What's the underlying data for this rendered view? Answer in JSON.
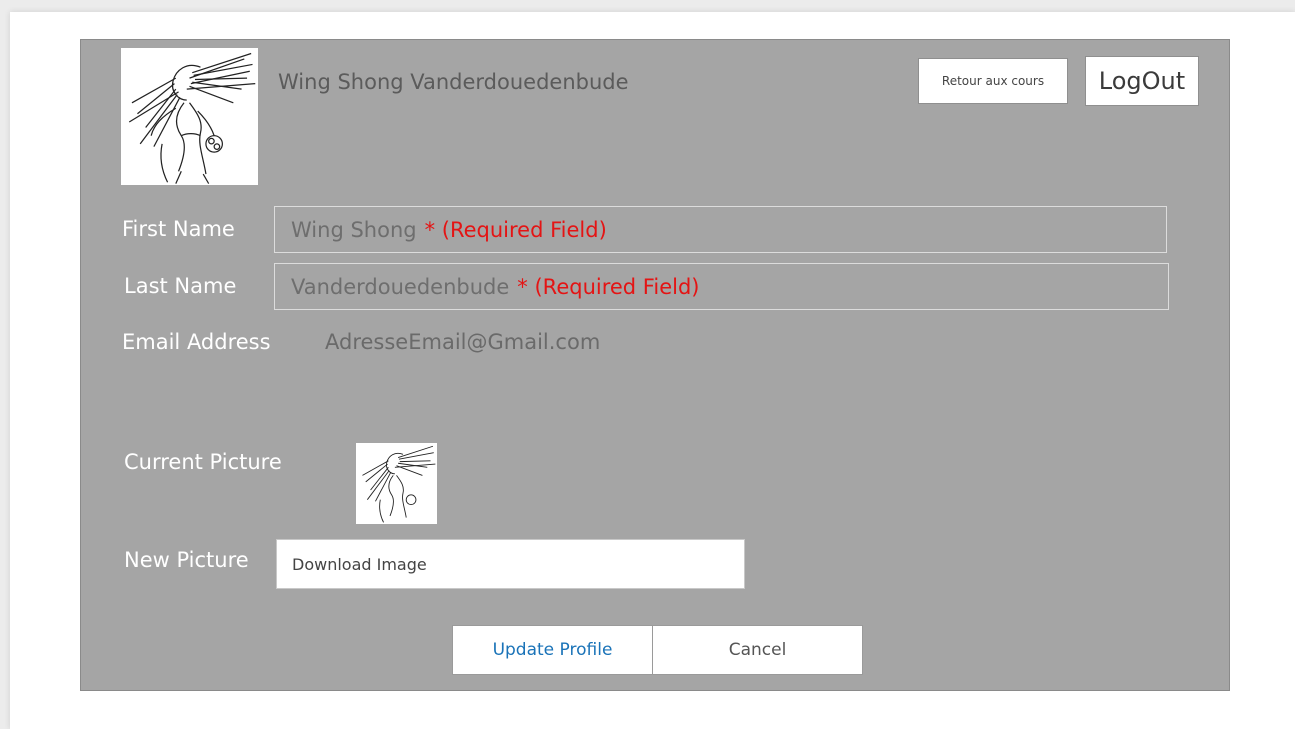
{
  "header": {
    "user_name": "Wing Shong Vanderdouedenbude",
    "back_button_label": "Retour aux cours",
    "logout_button_label": "LogOut",
    "avatar_icon": "profile-sketch-image"
  },
  "form": {
    "first_name": {
      "label": "First Name",
      "value": "Wing Shong",
      "required_text": "* (Required Field)"
    },
    "last_name": {
      "label": "Last Name",
      "value": "Vanderdouedenbude",
      "required_text": "* (Required Field)"
    },
    "email": {
      "label": "Email Address",
      "value": "AdresseEmail@Gmail.com"
    },
    "current_picture": {
      "label": "Current Picture"
    },
    "new_picture": {
      "label": "New Picture",
      "button_text": "Download Image"
    }
  },
  "actions": {
    "update_label": "Update Profile",
    "cancel_label": "Cancel"
  },
  "colors": {
    "panel_background": "#a5a5a5",
    "required_text": "#e41414",
    "link_blue": "#1a73b8"
  }
}
